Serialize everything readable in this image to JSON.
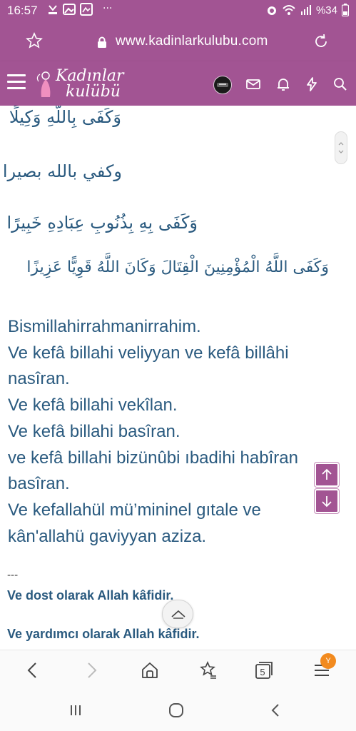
{
  "status_bar": {
    "time": "16:57",
    "ellipsis": "···",
    "battery": "%34",
    "left_icons": [
      "missed-call-icon",
      "image-icon",
      "gallery-icon"
    ],
    "right_icons": [
      "alarm-icon",
      "wifi-icon",
      "signal-icon",
      "battery-icon"
    ]
  },
  "url_bar": {
    "url": "www.kadinlarkulubu.com"
  },
  "site_header": {
    "logo_line1": "Kadınlar",
    "logo_line2": "kulübü"
  },
  "content": {
    "arabic_lines": [
      "وَكَفَى بِاللَّهِ وَكِيلًا",
      "وكفي بالله بصيرا",
      "وَكَفَى بِهِ بِذُنُوبِ عِبَادِهِ خَبِيرًا",
      "وَكَفَى اللَّهُ الْمُؤْمِنِينَ الْقِتَالَ وَكَانَ اللَّهُ قَوِيًّا عَزِيزًا"
    ],
    "turkish_lines": [
      "Bismillahirrahmanirrahim.",
      "Ve kefâ billahi veliyyan ve kefâ billâhi",
      "nasîran.",
      "Ve kefâ billahi vekîlan.",
      "Ve kefâ billahi basîran.",
      "ve kefâ billahi bizünûbi ıbadihi habîran",
      "basîran.",
      "Ve kefallahül mü’mininel gıtale ve",
      "kân'allahü gaviyyan aziza."
    ],
    "separator": "---",
    "bold_lines": [
      "Ve dost olarak Allah kâfidir.",
      "Ve yardımcı olarak Allah kâfidir."
    ]
  },
  "toolbar": {
    "tab_count": "5",
    "notification_badge": "Y"
  },
  "colors": {
    "brand": "#a25493",
    "text_blue": "#2a5a7f",
    "badge_orange": "#f28a1e"
  }
}
